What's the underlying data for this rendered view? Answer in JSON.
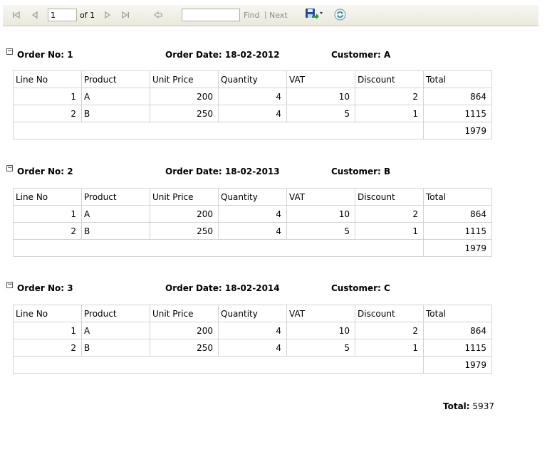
{
  "toolbar": {
    "page_value": "1",
    "of_label": "of 1",
    "find_label": "Find",
    "separator": "|",
    "next_label": "Next",
    "find_placeholder": ""
  },
  "columns": [
    "Line No",
    "Product",
    "Unit Price",
    "Quantity",
    "VAT",
    "Discount",
    "Total"
  ],
  "labels": {
    "order_no": "Order No:",
    "order_date": "Order Date:",
    "customer": "Customer:",
    "grand_total": "Total:"
  },
  "orders": [
    {
      "no": "1",
      "date": "18-02-2012",
      "customer": "A",
      "lines": [
        [
          "1",
          "A",
          "200",
          "4",
          "10",
          "2",
          "864"
        ],
        [
          "2",
          "B",
          "250",
          "4",
          "5",
          "1",
          "1115"
        ]
      ],
      "subtotal": "1979"
    },
    {
      "no": "2",
      "date": "18-02-2013",
      "customer": "B",
      "lines": [
        [
          "1",
          "A",
          "200",
          "4",
          "10",
          "2",
          "864"
        ],
        [
          "2",
          "B",
          "250",
          "4",
          "5",
          "1",
          "1115"
        ]
      ],
      "subtotal": "1979"
    },
    {
      "no": "3",
      "date": "18-02-2014",
      "customer": "C",
      "lines": [
        [
          "1",
          "A",
          "200",
          "4",
          "10",
          "2",
          "864"
        ],
        [
          "2",
          "B",
          "250",
          "4",
          "5",
          "1",
          "1115"
        ]
      ],
      "subtotal": "1979"
    }
  ],
  "grand_total": "5937",
  "colors": {
    "toolbar_top": "#f7f6f1",
    "toolbar_bottom": "#ebe9dc",
    "grid_line": "#d3d3d3",
    "disabled_text": "#8b8b8b",
    "save_icon": "#1f4f9c",
    "refresh_icon": "#2e8b57"
  }
}
